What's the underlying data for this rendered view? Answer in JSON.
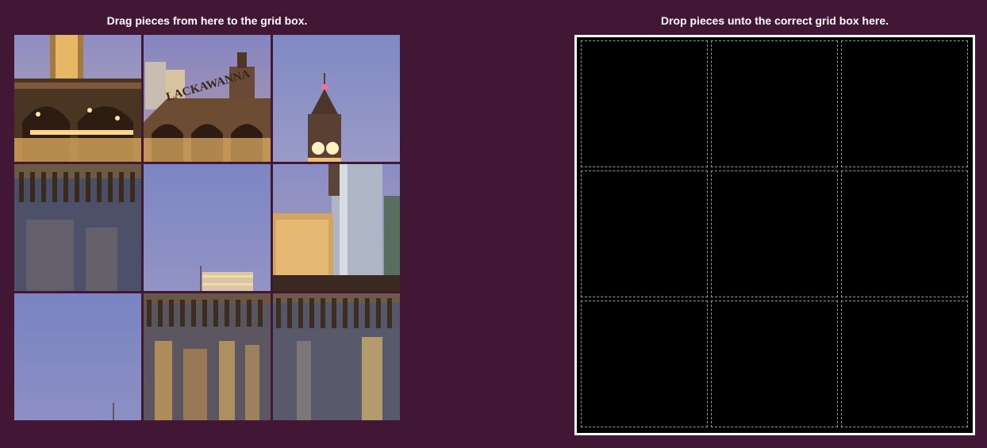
{
  "source_area": {
    "caption": "Drag pieces from here to the grid box.",
    "pieces": [
      {
        "name": "terminal-arch-left",
        "text": ""
      },
      {
        "name": "lackawanna-terminal",
        "text": "LACKAWANNA"
      },
      {
        "name": "clock-tower",
        "text": ""
      },
      {
        "name": "pier-reflection-left",
        "text": ""
      },
      {
        "name": "sky-with-building-top",
        "text": ""
      },
      {
        "name": "skyline-towers",
        "text": ""
      },
      {
        "name": "sky-corner",
        "text": ""
      },
      {
        "name": "pier-reflection-center",
        "text": ""
      },
      {
        "name": "pier-reflection-right",
        "text": ""
      }
    ]
  },
  "drop_area": {
    "caption": "Drop pieces unto the correct grid box here.",
    "rows": 3,
    "columns": 3
  },
  "colors": {
    "background": "#421735",
    "drop_background": "#000000",
    "drop_border": "#ffffff"
  }
}
